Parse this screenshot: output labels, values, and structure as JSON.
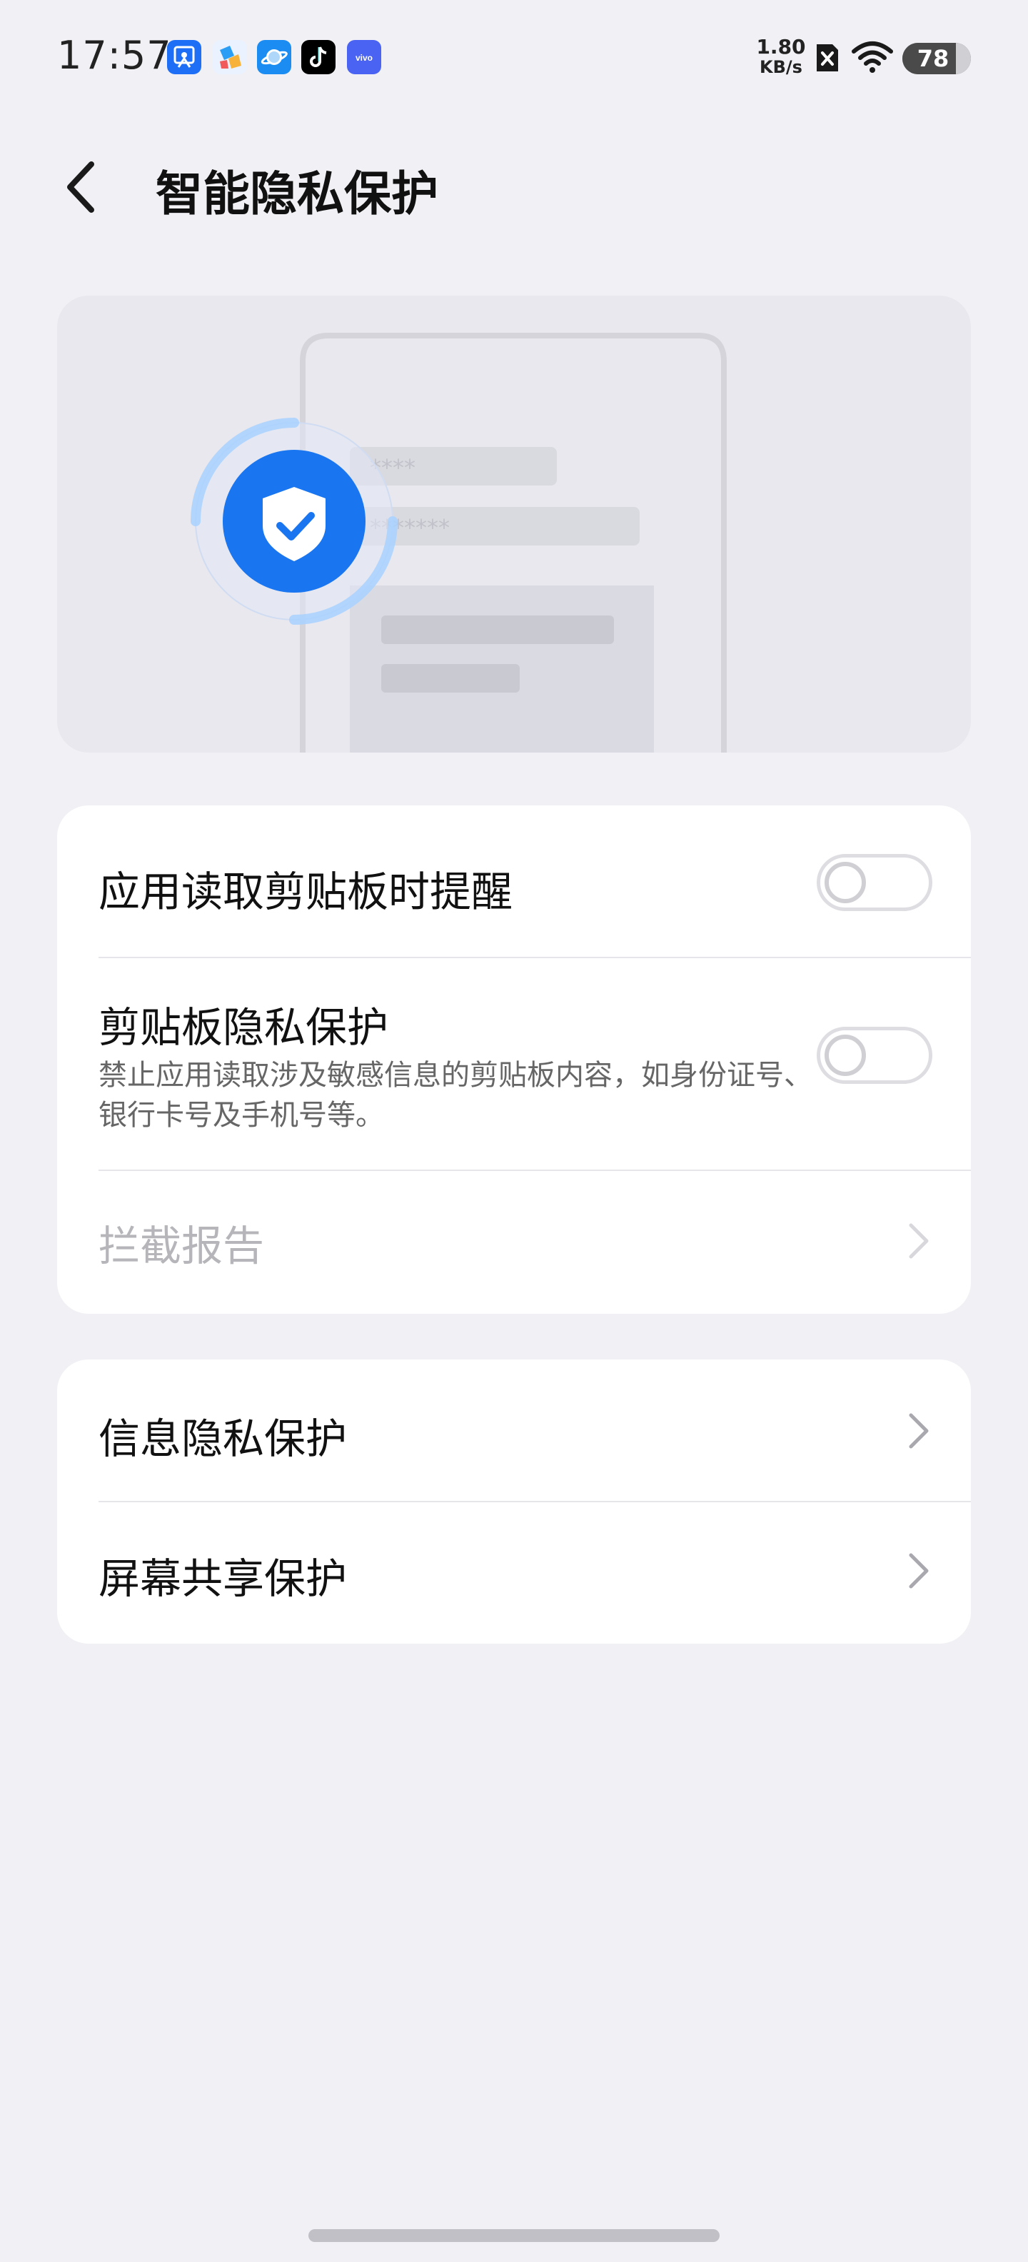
{
  "status_bar": {
    "time": "17:57",
    "notification_icons": [
      {
        "name": "screenshot-app-icon",
        "color": "#1e6ff5"
      },
      {
        "name": "colorful-app-icon",
        "color": "#2a9df4"
      },
      {
        "name": "browser-planet-icon",
        "color": "#1b8cf2"
      },
      {
        "name": "tiktok-icon",
        "color": "#000000"
      },
      {
        "name": "vivo-icon",
        "color": "#4a63f3"
      }
    ],
    "net_speed_value": "1.80",
    "net_speed_unit": "KB/s",
    "battery_level": "78"
  },
  "header": {
    "title": "智能隐私保护"
  },
  "hero": {
    "masked_field_1": "****",
    "masked_field_2": "*******",
    "shield_color": "#1976f0"
  },
  "settings_group_1": {
    "items": [
      {
        "label": "应用读取剪贴板时提醒",
        "toggle_on": false
      },
      {
        "label": "剪贴板隐私保护",
        "description": "禁止应用读取涉及敏感信息的剪贴板内容，如身份证号、银行卡号及手机号等。",
        "toggle_on": false
      },
      {
        "label": "拦截报告",
        "disabled": true
      }
    ]
  },
  "settings_group_2": {
    "items": [
      {
        "label": "信息隐私保护"
      },
      {
        "label": "屏幕共享保护"
      }
    ]
  }
}
